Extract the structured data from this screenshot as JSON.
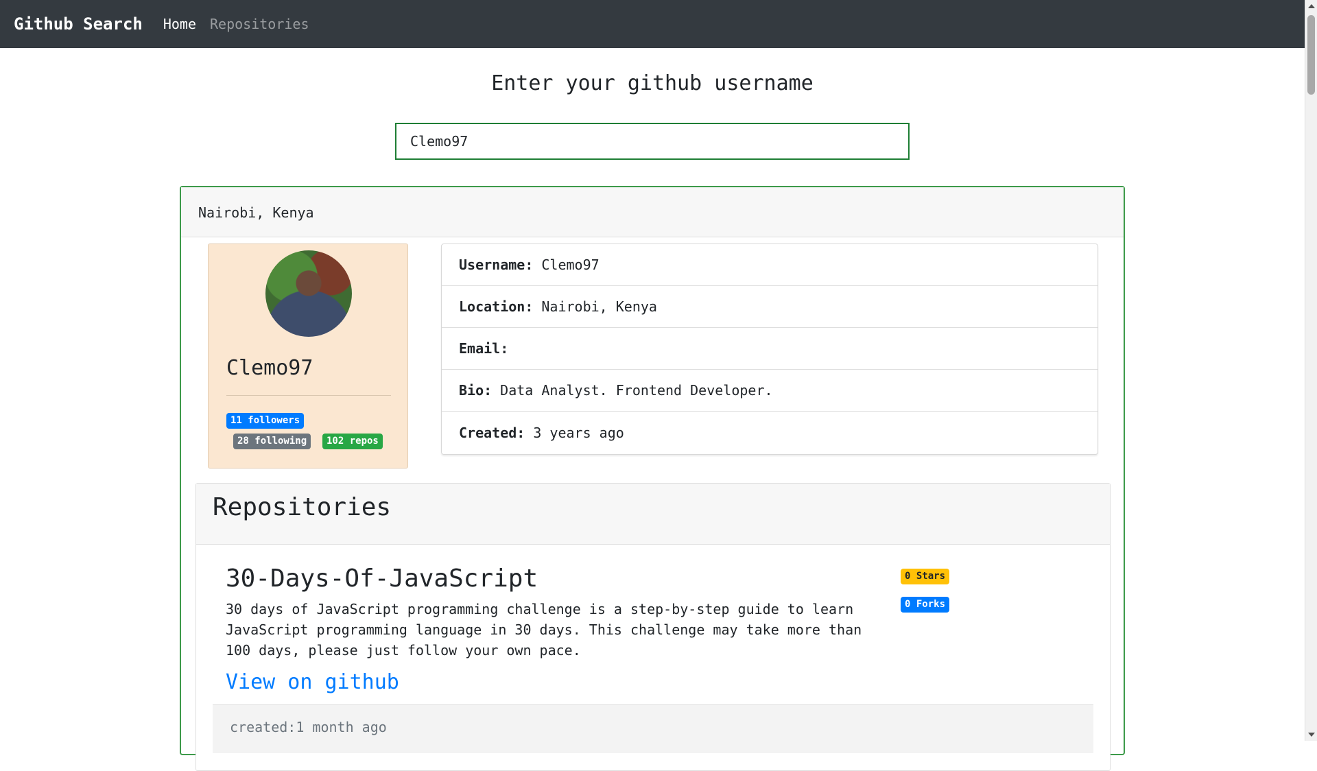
{
  "navbar": {
    "brand": "Github Search",
    "links": [
      {
        "label": "Home",
        "active": true
      },
      {
        "label": "Repositories",
        "active": false
      }
    ]
  },
  "search": {
    "title": "Enter your github username",
    "value": "Clemo97"
  },
  "profile": {
    "header_location": "Nairobi, Kenya",
    "login": "Clemo97",
    "badges": {
      "followers": "11 followers",
      "following": "28 following",
      "repos": "102 repos"
    },
    "details": [
      {
        "label": "Username:",
        "value": "Clemo97"
      },
      {
        "label": "Location:",
        "value": "Nairobi, Kenya"
      },
      {
        "label": "Email:",
        "value": ""
      },
      {
        "label": "Bio:",
        "value": "Data Analyst. Frontend Developer."
      },
      {
        "label": "Created:",
        "value": "3 years ago"
      }
    ]
  },
  "repositories": {
    "title": "Repositories",
    "items": [
      {
        "name": "30-Days-Of-JavaScript",
        "description": "30 days of JavaScript programming challenge is a step-by-step guide to learn JavaScript programming language in 30 days. This challenge may take more than 100 days, please just follow your own pace.",
        "stars": "0 Stars",
        "forks": "0 Forks",
        "link_label": "View on github",
        "created": "created:1 month ago"
      }
    ]
  },
  "colors": {
    "navbar": "#343a40",
    "input_border": "#1e7e34",
    "card_border": "#3d9a4a",
    "user_panel": "#fbe7d1",
    "link": "#007bff"
  }
}
